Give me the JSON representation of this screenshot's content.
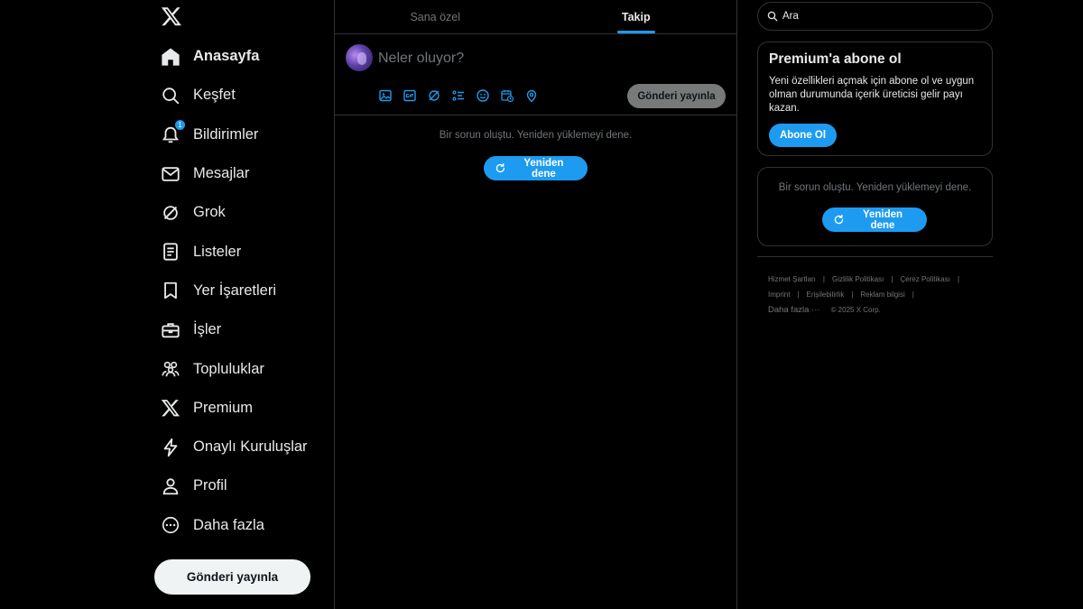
{
  "sidebar": {
    "items": [
      {
        "label": "Anasayfa",
        "icon": "home-icon",
        "active": true
      },
      {
        "label": "Keşfet",
        "icon": "search-icon"
      },
      {
        "label": "Bildirimler",
        "icon": "bell-icon",
        "badge": "1"
      },
      {
        "label": "Mesajlar",
        "icon": "mail-icon"
      },
      {
        "label": "Grok",
        "icon": "grok-icon"
      },
      {
        "label": "Listeler",
        "icon": "list-icon"
      },
      {
        "label": "Yer İşaretleri",
        "icon": "bookmark-icon"
      },
      {
        "label": "İşler",
        "icon": "briefcase-icon"
      },
      {
        "label": "Topluluklar",
        "icon": "communities-icon"
      },
      {
        "label": "Premium",
        "icon": "x-logo-icon"
      },
      {
        "label": "Onaylı Kuruluşlar",
        "icon": "lightning-icon"
      },
      {
        "label": "Profil",
        "icon": "person-icon"
      },
      {
        "label": "Daha fazla",
        "icon": "more-circle-icon"
      }
    ],
    "post_button": "Gönderi yayınla"
  },
  "main": {
    "tabs": [
      {
        "label": "Sana özel",
        "active": false
      },
      {
        "label": "Takip",
        "active": true
      }
    ],
    "composer": {
      "placeholder": "Neler oluyor?",
      "tools": [
        "image-icon",
        "gif-icon",
        "grok-icon",
        "poll-icon",
        "emoji-icon",
        "schedule-icon",
        "location-icon"
      ],
      "post_button": "Gönderi yayınla"
    },
    "error": {
      "message": "Bir sorun oluştu. Yeniden yüklemeyi dene.",
      "retry": "Yeniden dene"
    }
  },
  "right": {
    "search": {
      "placeholder": "Ara"
    },
    "premium": {
      "title": "Premium'a abone ol",
      "body": "Yeni özellikleri açmak için abone ol ve uygun olman durumunda içerik üreticisi gelir payı kazan.",
      "button": "Abone Ol"
    },
    "error": {
      "message": "Bir sorun oluştu. Yeniden yüklemeyi dene.",
      "retry": "Yeniden dene"
    },
    "footer": {
      "links_row1": [
        "Hizmet Şartları",
        "Gizlilik Politikası",
        "Çerez Politikası"
      ],
      "links_row2": [
        "Imprint",
        "Erişilebilirlik",
        "Reklam bilgisi"
      ],
      "more": "Daha fazla ···",
      "copyright": "© 2025 X Corp."
    }
  },
  "colors": {
    "accent": "#1d9bf0",
    "background": "#000000",
    "border": "#2f3336",
    "muted": "#71767b"
  }
}
